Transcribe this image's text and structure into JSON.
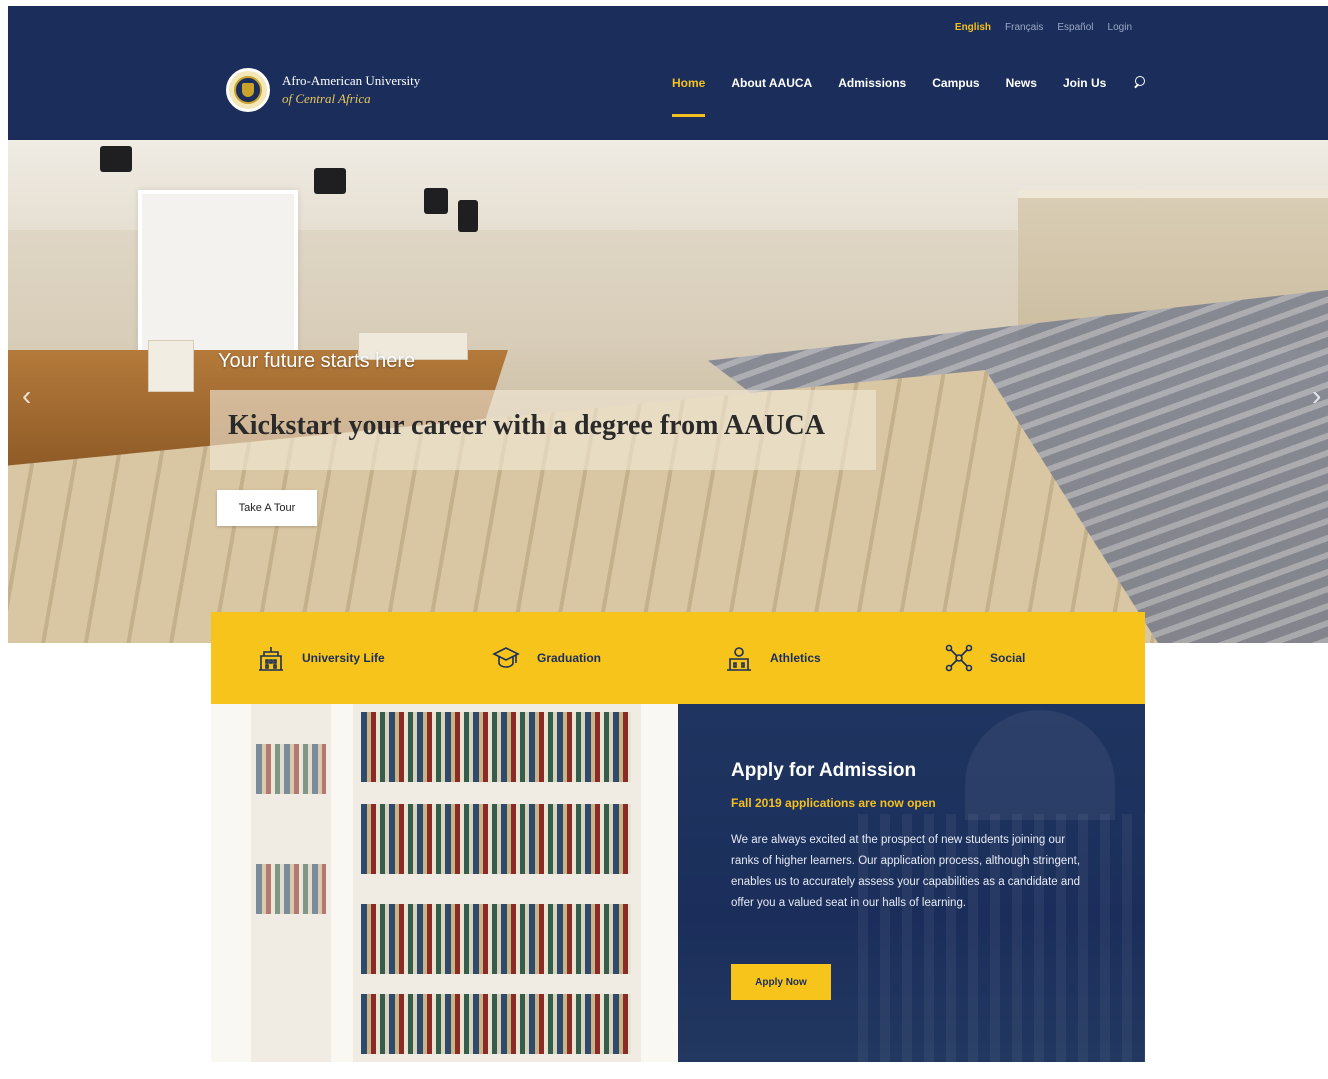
{
  "topbar": {
    "languages": [
      "English",
      "Français",
      "Español"
    ],
    "login_label": "Login"
  },
  "logo": {
    "line1": "Afro-American University",
    "line2": "of Central Africa"
  },
  "nav": {
    "items": [
      "Home",
      "About AAUCA",
      "Admissions",
      "Campus",
      "News",
      "Join Us"
    ],
    "active": "Home",
    "search_icon": "search-icon"
  },
  "hero": {
    "kicker": "Your future starts here",
    "title": "Kickstart your career with a degree from AAUCA",
    "button_label": "Take A Tour",
    "prev_icon": "chevron-left-icon",
    "next_icon": "chevron-right-icon"
  },
  "categories": [
    {
      "label": "University Life",
      "icon": "university-building-icon"
    },
    {
      "label": "Graduation",
      "icon": "graduation-cap-icon"
    },
    {
      "label": "Athletics",
      "icon": "athletics-trophy-icon"
    },
    {
      "label": "Social",
      "icon": "social-network-icon"
    }
  ],
  "admission": {
    "title": "Apply for Admission",
    "subtitle": "Fall 2019 applications are now open",
    "body": "We are always excited at the prospect of new students joining our ranks of higher learners. Our application process, although stringent, enables us to accurately assess your capabilities as a candidate and offer you a valued seat in our halls of learning.",
    "button_label": "Apply Now"
  },
  "colors": {
    "navy": "#1b2e5b",
    "gold": "#f7c41c",
    "accent_gold": "#f4c01f"
  }
}
